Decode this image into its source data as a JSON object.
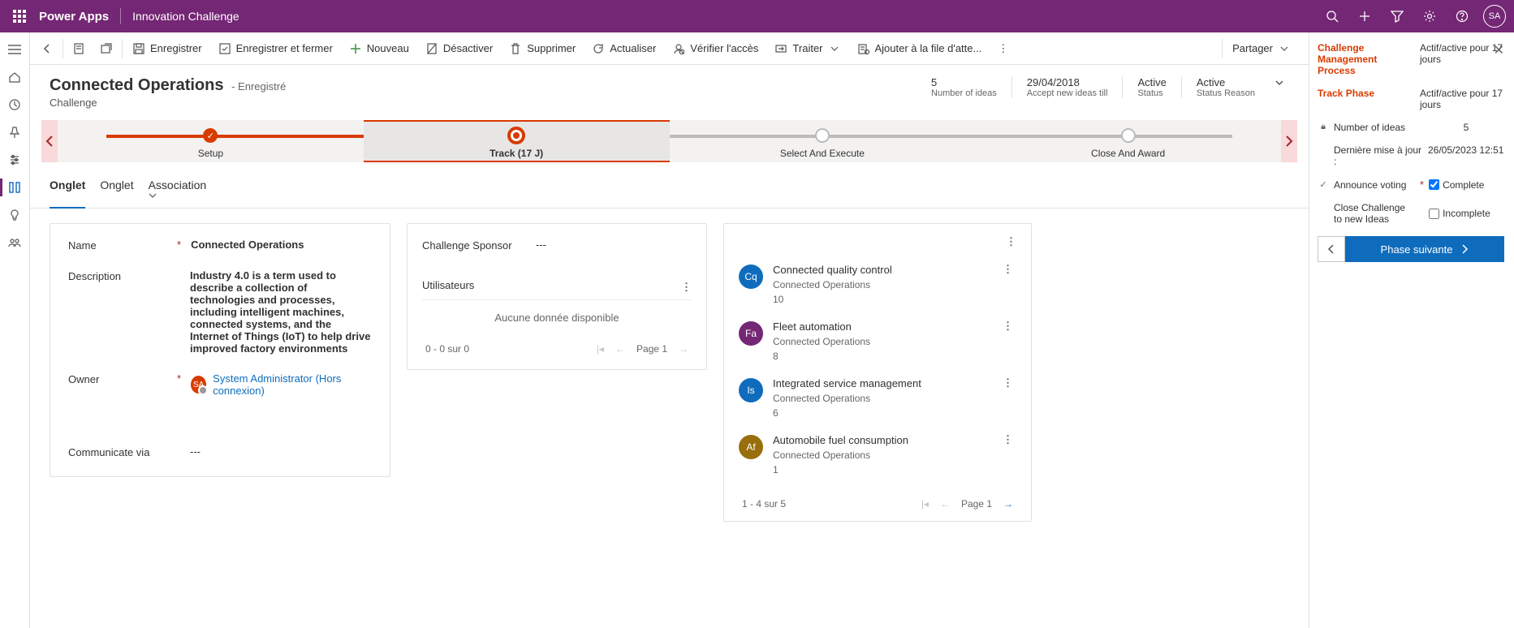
{
  "topbar": {
    "appName": "Power Apps",
    "breadcrumb": "Innovation Challenge",
    "avatarInitials": "SA"
  },
  "commandBar": {
    "save": "Enregistrer",
    "saveClose": "Enregistrer et fermer",
    "new": "Nouveau",
    "deactivate": "Désactiver",
    "delete": "Supprimer",
    "refresh": "Actualiser",
    "checkAccess": "Vérifier l'accès",
    "process": "Traiter",
    "addToQueue": "Ajouter à la file d'atte...",
    "share": "Partager"
  },
  "header": {
    "title": "Connected Operations",
    "saveState": "- Enregistré",
    "entity": "Challenge",
    "stats": {
      "ideasValue": "5",
      "ideasLabel": "Number of ideas",
      "acceptValue": "29/04/2018",
      "acceptLabel": "Accept new ideas till",
      "statusValue": "Active",
      "statusLabel": "Status",
      "reasonValue": "Active",
      "reasonLabel": "Status Reason"
    }
  },
  "stages": {
    "s1": "Setup",
    "s2": "Track  (17 J)",
    "s3": "Select And Execute",
    "s4": "Close And Award"
  },
  "tabs": {
    "t1": "Onglet",
    "t2": "Onglet",
    "t3": "Association"
  },
  "form": {
    "nameLabel": "Name",
    "nameValue": "Connected Operations",
    "descLabel": "Description",
    "descValue": "Industry 4.0 is a term used to describe a collection of technologies and processes, including intelligent machines, connected systems, and the Internet of Things (IoT) to help drive improved factory environments",
    "ownerLabel": "Owner",
    "ownerName": "System Administrator (Hors connexion)",
    "ownerInitials": "SA",
    "commLabel": "Communicate via",
    "commValue": "---"
  },
  "col2": {
    "sponsorLabel": "Challenge Sponsor",
    "sponsorValue": "---",
    "usersTitle": "Utilisateurs",
    "emptyText": "Aucune donnée disponible",
    "pager": "0 - 0 sur 0",
    "pageLabel": "Page 1"
  },
  "ideas": {
    "list": [
      {
        "initials": "Cq",
        "color": "#0f6cbd",
        "title": "Connected quality control",
        "sub": "Connected Operations",
        "count": "10"
      },
      {
        "initials": "Fa",
        "color": "#742774",
        "title": "Fleet automation",
        "sub": "Connected Operations",
        "count": "8"
      },
      {
        "initials": "Is",
        "color": "#0f6cbd",
        "title": "Integrated service management",
        "sub": "Connected Operations",
        "count": "6"
      },
      {
        "initials": "Af",
        "color": "#986f0b",
        "title": "Automobile fuel consumption",
        "sub": "Connected Operations",
        "count": "1"
      }
    ],
    "pager": "1 - 4 sur 5",
    "pageLabel": "Page 1"
  },
  "rightPanel": {
    "processLabel": "Challenge Management Process",
    "processStatus": "Actif/active pour 17 jours",
    "trackLabel": "Track Phase",
    "trackStatus": "Actif/active pour 17 jours",
    "ideasLabel": "Number of ideas",
    "ideasValue": "5",
    "updatedLabel": "Dernière mise à jour :",
    "updatedValue": "26/05/2023 12:51",
    "announceLabel": "Announce voting",
    "completeLabel": "Complete",
    "closeLabel": "Close Challenge to new Ideas",
    "incompleteLabel": "Incomplete",
    "nextPhase": "Phase suivante"
  }
}
